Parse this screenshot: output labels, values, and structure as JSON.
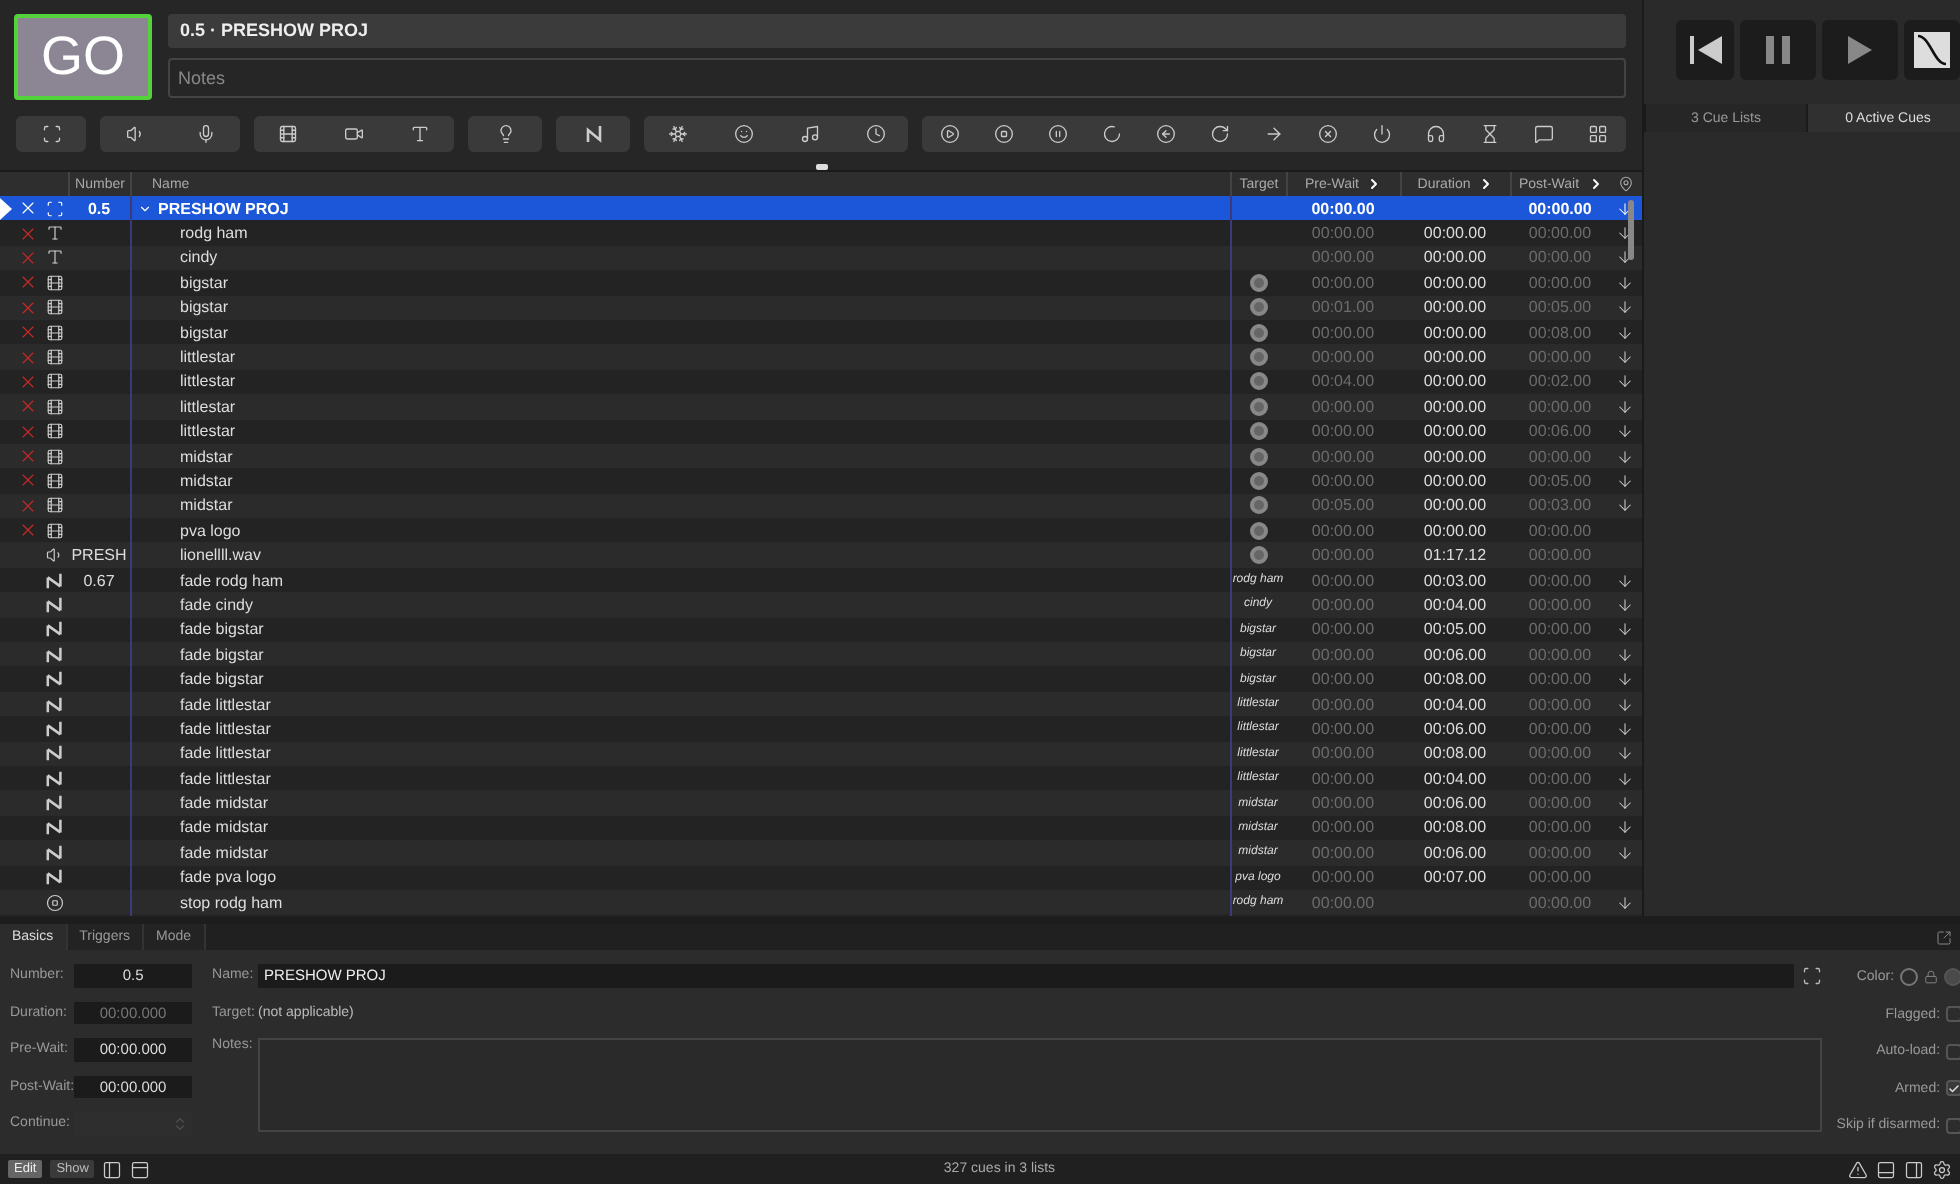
{
  "go_button": "GO",
  "cue_title": "0.5 · PRESHOW PROJ",
  "notes": {
    "placeholder": "Notes"
  },
  "columns": [
    {
      "label": "Number",
      "chevron": false
    },
    {
      "label": "Name",
      "chevron": false
    },
    {
      "label": "Target",
      "chevron": false
    },
    {
      "label": "Pre-Wait",
      "chevron": true
    },
    {
      "label": "Duration",
      "chevron": true
    },
    {
      "label": "Post-Wait",
      "chevron": true
    }
  ],
  "cues": [
    {
      "kind": "group",
      "number": "0.5",
      "name": "PRESHOW PROJ",
      "pre_wait": "00:00.00",
      "post_wait": "00:00.00",
      "broken": true,
      "continue": true,
      "selected": true,
      "playhead": true,
      "expanded": true,
      "children": [
        {
          "kind": "text",
          "name": "rodg ham",
          "pre_wait": "00:00.00",
          "duration": "00:00.00",
          "post_wait": "00:00.00",
          "broken": true,
          "continue": true,
          "selected": false
        },
        {
          "kind": "text",
          "name": "cindy",
          "pre_wait": "00:00.00",
          "duration": "00:00.00",
          "post_wait": "00:00.00",
          "broken": true,
          "continue": true,
          "selected": false
        },
        {
          "kind": "video",
          "name": "bigstar",
          "target_badge": true,
          "pre_wait": "00:00.00",
          "duration": "00:00.00",
          "post_wait": "00:00.00",
          "broken": true,
          "continue": true,
          "selected": false
        },
        {
          "kind": "video",
          "name": "bigstar",
          "target_badge": true,
          "pre_wait": "00:01.00",
          "duration": "00:00.00",
          "post_wait": "00:05.00",
          "broken": true,
          "continue": true,
          "selected": false
        },
        {
          "kind": "video",
          "name": "bigstar",
          "target_badge": true,
          "pre_wait": "00:00.00",
          "duration": "00:00.00",
          "post_wait": "00:08.00",
          "broken": true,
          "continue": true,
          "selected": false
        },
        {
          "kind": "video",
          "name": "littlestar",
          "target_badge": true,
          "pre_wait": "00:00.00",
          "duration": "00:00.00",
          "post_wait": "00:00.00",
          "broken": true,
          "continue": true,
          "selected": false
        },
        {
          "kind": "video",
          "name": "littlestar",
          "target_badge": true,
          "pre_wait": "00:04.00",
          "duration": "00:00.00",
          "post_wait": "00:02.00",
          "broken": true,
          "continue": true,
          "selected": false
        },
        {
          "kind": "video",
          "name": "littlestar",
          "target_badge": true,
          "pre_wait": "00:00.00",
          "duration": "00:00.00",
          "post_wait": "00:00.00",
          "broken": true,
          "continue": true,
          "selected": false
        },
        {
          "kind": "video",
          "name": "littlestar",
          "target_badge": true,
          "pre_wait": "00:00.00",
          "duration": "00:00.00",
          "post_wait": "00:06.00",
          "broken": true,
          "continue": true,
          "selected": false
        },
        {
          "kind": "video",
          "name": "midstar",
          "target_badge": true,
          "pre_wait": "00:00.00",
          "duration": "00:00.00",
          "post_wait": "00:00.00",
          "broken": true,
          "continue": true,
          "selected": false
        },
        {
          "kind": "video",
          "name": "midstar",
          "target_badge": true,
          "pre_wait": "00:00.00",
          "duration": "00:00.00",
          "post_wait": "00:05.00",
          "broken": true,
          "continue": true,
          "selected": false
        },
        {
          "kind": "video",
          "name": "midstar",
          "target_badge": true,
          "pre_wait": "00:05.00",
          "duration": "00:00.00",
          "post_wait": "00:03.00",
          "broken": true,
          "continue": true,
          "selected": false
        },
        {
          "kind": "video",
          "name": "pva logo",
          "target_badge": true,
          "pre_wait": "00:00.00",
          "duration": "00:00.00",
          "post_wait": "00:00.00",
          "broken": true,
          "continue": false,
          "selected": false
        },
        {
          "kind": "audio",
          "number": "PRESH",
          "name": "lionellll.wav",
          "target_badge": true,
          "pre_wait": "00:00.00",
          "duration": "01:17.12",
          "post_wait": "00:00.00",
          "broken": false,
          "continue": false,
          "selected": false
        },
        {
          "kind": "fade",
          "number": "0.67",
          "name": "fade rodg ham",
          "target": "rodg ham",
          "pre_wait": "00:00.00",
          "duration": "00:03.00",
          "post_wait": "00:00.00",
          "broken": false,
          "continue": true,
          "selected": false
        },
        {
          "kind": "fade",
          "name": "fade cindy",
          "target": "cindy",
          "pre_wait": "00:00.00",
          "duration": "00:04.00",
          "post_wait": "00:00.00",
          "broken": false,
          "continue": true,
          "selected": false
        },
        {
          "kind": "fade",
          "name": "fade bigstar",
          "target": "bigstar",
          "pre_wait": "00:00.00",
          "duration": "00:05.00",
          "post_wait": "00:00.00",
          "broken": false,
          "continue": true,
          "selected": false
        },
        {
          "kind": "fade",
          "name": "fade bigstar",
          "target": "bigstar",
          "pre_wait": "00:00.00",
          "duration": "00:06.00",
          "post_wait": "00:00.00",
          "broken": false,
          "continue": true,
          "selected": false
        },
        {
          "kind": "fade",
          "name": "fade bigstar",
          "target": "bigstar",
          "pre_wait": "00:00.00",
          "duration": "00:08.00",
          "post_wait": "00:00.00",
          "broken": false,
          "continue": true,
          "selected": false
        },
        {
          "kind": "fade",
          "name": "fade littlestar",
          "target": "littlestar",
          "pre_wait": "00:00.00",
          "duration": "00:04.00",
          "post_wait": "00:00.00",
          "broken": false,
          "continue": true,
          "selected": false
        },
        {
          "kind": "fade",
          "name": "fade littlestar",
          "target": "littlestar",
          "pre_wait": "00:00.00",
          "duration": "00:06.00",
          "post_wait": "00:00.00",
          "broken": false,
          "continue": true,
          "selected": false
        },
        {
          "kind": "fade",
          "name": "fade littlestar",
          "target": "littlestar",
          "pre_wait": "00:00.00",
          "duration": "00:08.00",
          "post_wait": "00:00.00",
          "broken": false,
          "continue": true,
          "selected": false
        },
        {
          "kind": "fade",
          "name": "fade littlestar",
          "target": "littlestar",
          "pre_wait": "00:00.00",
          "duration": "00:04.00",
          "post_wait": "00:00.00",
          "broken": false,
          "continue": true,
          "selected": false
        },
        {
          "kind": "fade",
          "name": "fade midstar",
          "target": "midstar",
          "pre_wait": "00:00.00",
          "duration": "00:06.00",
          "post_wait": "00:00.00",
          "broken": false,
          "continue": true,
          "selected": false
        },
        {
          "kind": "fade",
          "name": "fade midstar",
          "target": "midstar",
          "pre_wait": "00:00.00",
          "duration": "00:08.00",
          "post_wait": "00:00.00",
          "broken": false,
          "continue": true,
          "selected": false
        },
        {
          "kind": "fade",
          "name": "fade midstar",
          "target": "midstar",
          "pre_wait": "00:00.00",
          "duration": "00:06.00",
          "post_wait": "00:00.00",
          "broken": false,
          "continue": true,
          "selected": false
        },
        {
          "kind": "fade",
          "name": "fade pva logo",
          "target": "pva logo",
          "pre_wait": "00:00.00",
          "duration": "00:07.00",
          "post_wait": "00:00.00",
          "broken": false,
          "continue": false,
          "selected": false
        },
        {
          "kind": "stop",
          "name": "stop rodg ham",
          "target": "rodg ham",
          "pre_wait": "00:00.00",
          "post_wait": "00:00.00",
          "broken": false,
          "continue": true,
          "selected": false
        }
      ]
    }
  ],
  "side_tabs": [
    {
      "label": "3 Cue Lists",
      "selected": false
    },
    {
      "label": "0 Active Cues",
      "selected": true
    }
  ],
  "inspector": {
    "tabs": [
      {
        "label": "Basics",
        "selected": true
      },
      {
        "label": "Triggers",
        "selected": false
      },
      {
        "label": "Mode",
        "selected": false
      }
    ],
    "fields": [
      {
        "label": "Number:",
        "kind": "text",
        "value": "0.5",
        "disabled": false
      },
      {
        "label": "Duration:",
        "kind": "text",
        "value": "00:00.000",
        "disabled": true
      },
      {
        "label": "Pre-Wait:",
        "kind": "text",
        "value": "00:00.000",
        "disabled": false
      },
      {
        "label": "Post-Wait:",
        "kind": "text",
        "value": "00:00.000",
        "disabled": false
      },
      {
        "label": "Continue:",
        "kind": "select",
        "disabled": true
      }
    ],
    "name": {
      "label": "Name:",
      "value": "PRESHOW PROJ"
    },
    "target": {
      "label": "Target:",
      "value": "(not applicable)"
    },
    "notes_label": "Notes:",
    "color_label": "Color:",
    "flags": [
      {
        "label": "Flagged:",
        "checked": false
      },
      {
        "label": "Auto-load:",
        "checked": false
      },
      {
        "label": "Armed:",
        "checked": true
      },
      {
        "label": "Skip if disarmed:",
        "checked": false
      }
    ]
  },
  "mode_buttons": [
    {
      "label": "Edit",
      "selected": true
    },
    {
      "label": "Show",
      "selected": false
    }
  ],
  "status": "327 cues in 3 lists"
}
